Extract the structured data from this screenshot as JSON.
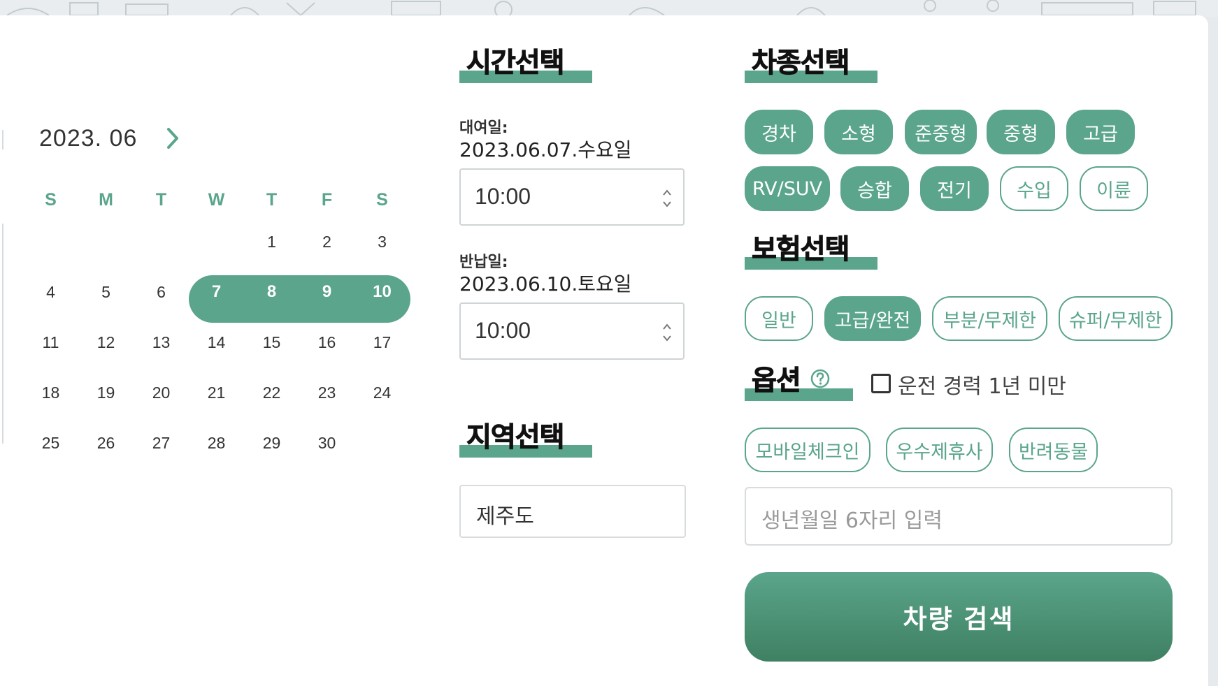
{
  "calendar": {
    "title": "2023. 06",
    "weekdays": [
      "S",
      "M",
      "T",
      "W",
      "T",
      "F",
      "S"
    ],
    "weeks": [
      [
        "",
        "",
        "",
        "",
        "1",
        "2",
        "3"
      ],
      [
        "4",
        "5",
        "6",
        "7",
        "8",
        "9",
        "10"
      ],
      [
        "11",
        "12",
        "13",
        "14",
        "15",
        "16",
        "17"
      ],
      [
        "18",
        "19",
        "20",
        "21",
        "22",
        "23",
        "24"
      ],
      [
        "25",
        "26",
        "27",
        "28",
        "29",
        "30",
        ""
      ]
    ],
    "selected_days": [
      "7",
      "8",
      "9",
      "10"
    ]
  },
  "time_section": {
    "heading": "시간선택",
    "rental_label": "대여일:",
    "rental_date": "2023.06.07.수요일",
    "rental_time": "10:00",
    "return_label": "반납일:",
    "return_date": "2023.06.10.토요일",
    "return_time": "10:00"
  },
  "region_section": {
    "heading": "지역선택",
    "value": "제주도"
  },
  "car_section": {
    "heading": "차종선택",
    "types": [
      {
        "label": "경차",
        "selected": true
      },
      {
        "label": "소형",
        "selected": true
      },
      {
        "label": "준중형",
        "selected": true
      },
      {
        "label": "중형",
        "selected": true
      },
      {
        "label": "고급",
        "selected": true
      },
      {
        "label": "RV/SUV",
        "selected": true
      },
      {
        "label": "승합",
        "selected": true
      },
      {
        "label": "전기",
        "selected": true
      },
      {
        "label": "수입",
        "selected": false
      },
      {
        "label": "이륜",
        "selected": false
      }
    ]
  },
  "insurance_section": {
    "heading": "보험선택",
    "types": [
      {
        "label": "일반",
        "selected": false
      },
      {
        "label": "고급/완전",
        "selected": true
      },
      {
        "label": "부분/무제한",
        "selected": false
      },
      {
        "label": "슈퍼/무제한",
        "selected": false
      }
    ]
  },
  "option_section": {
    "heading": "옵션",
    "help_icon": "question-circle-icon",
    "checkbox_label": "운전 경력 1년 미만",
    "checkbox_checked": false,
    "options": [
      {
        "label": "모바일체크인",
        "selected": false
      },
      {
        "label": "우수제휴사",
        "selected": false
      },
      {
        "label": "반려동물",
        "selected": false
      }
    ],
    "birth_placeholder": "생년월일 6자리 입력"
  },
  "search_button": {
    "label": "차량 검색"
  },
  "colors": {
    "accent": "#5aa58b",
    "accent_dark": "#3f8062"
  }
}
